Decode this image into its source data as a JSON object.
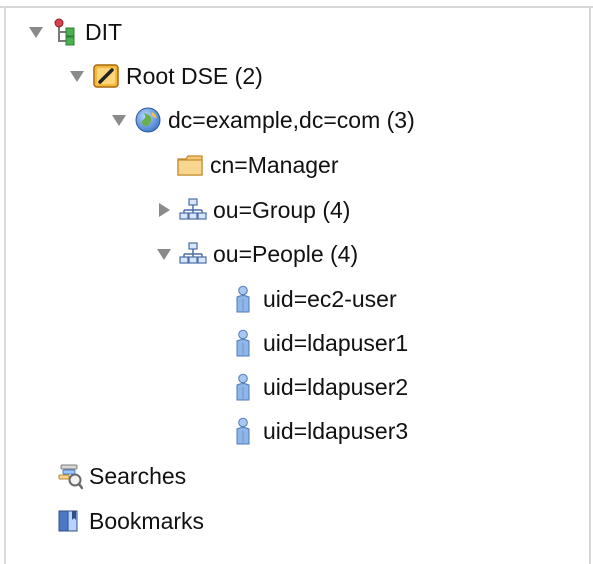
{
  "tree": {
    "root": {
      "label": "DIT",
      "icon": "dit-tree-icon",
      "expanded": true
    },
    "root_dse": {
      "label": "Root DSE (2)",
      "icon": "root-dse-icon",
      "expanded": true
    },
    "domain": {
      "label": "dc=example,dc=com (3)",
      "icon": "globe-icon",
      "expanded": true
    },
    "manager": {
      "label": "cn=Manager",
      "icon": "folder-icon"
    },
    "group": {
      "label": "ou=Group (4)",
      "icon": "org-unit-icon",
      "expanded": false
    },
    "people": {
      "label": "ou=People (4)",
      "icon": "org-unit-icon",
      "expanded": true
    },
    "users": [
      {
        "label": "uid=ec2-user",
        "icon": "person-icon"
      },
      {
        "label": "uid=ldapuser1",
        "icon": "person-icon"
      },
      {
        "label": "uid=ldapuser2",
        "icon": "person-icon"
      },
      {
        "label": "uid=ldapuser3",
        "icon": "person-icon"
      }
    ],
    "searches": {
      "label": "Searches",
      "icon": "searches-icon"
    },
    "bookmarks": {
      "label": "Bookmarks",
      "icon": "bookmarks-icon"
    }
  },
  "colors": {
    "twisty": "#8a8a8a",
    "border": "#d6d6d6",
    "folder": "#f5c96a",
    "person": "#8fb6e8",
    "org_unit": "#4a6fa5"
  }
}
